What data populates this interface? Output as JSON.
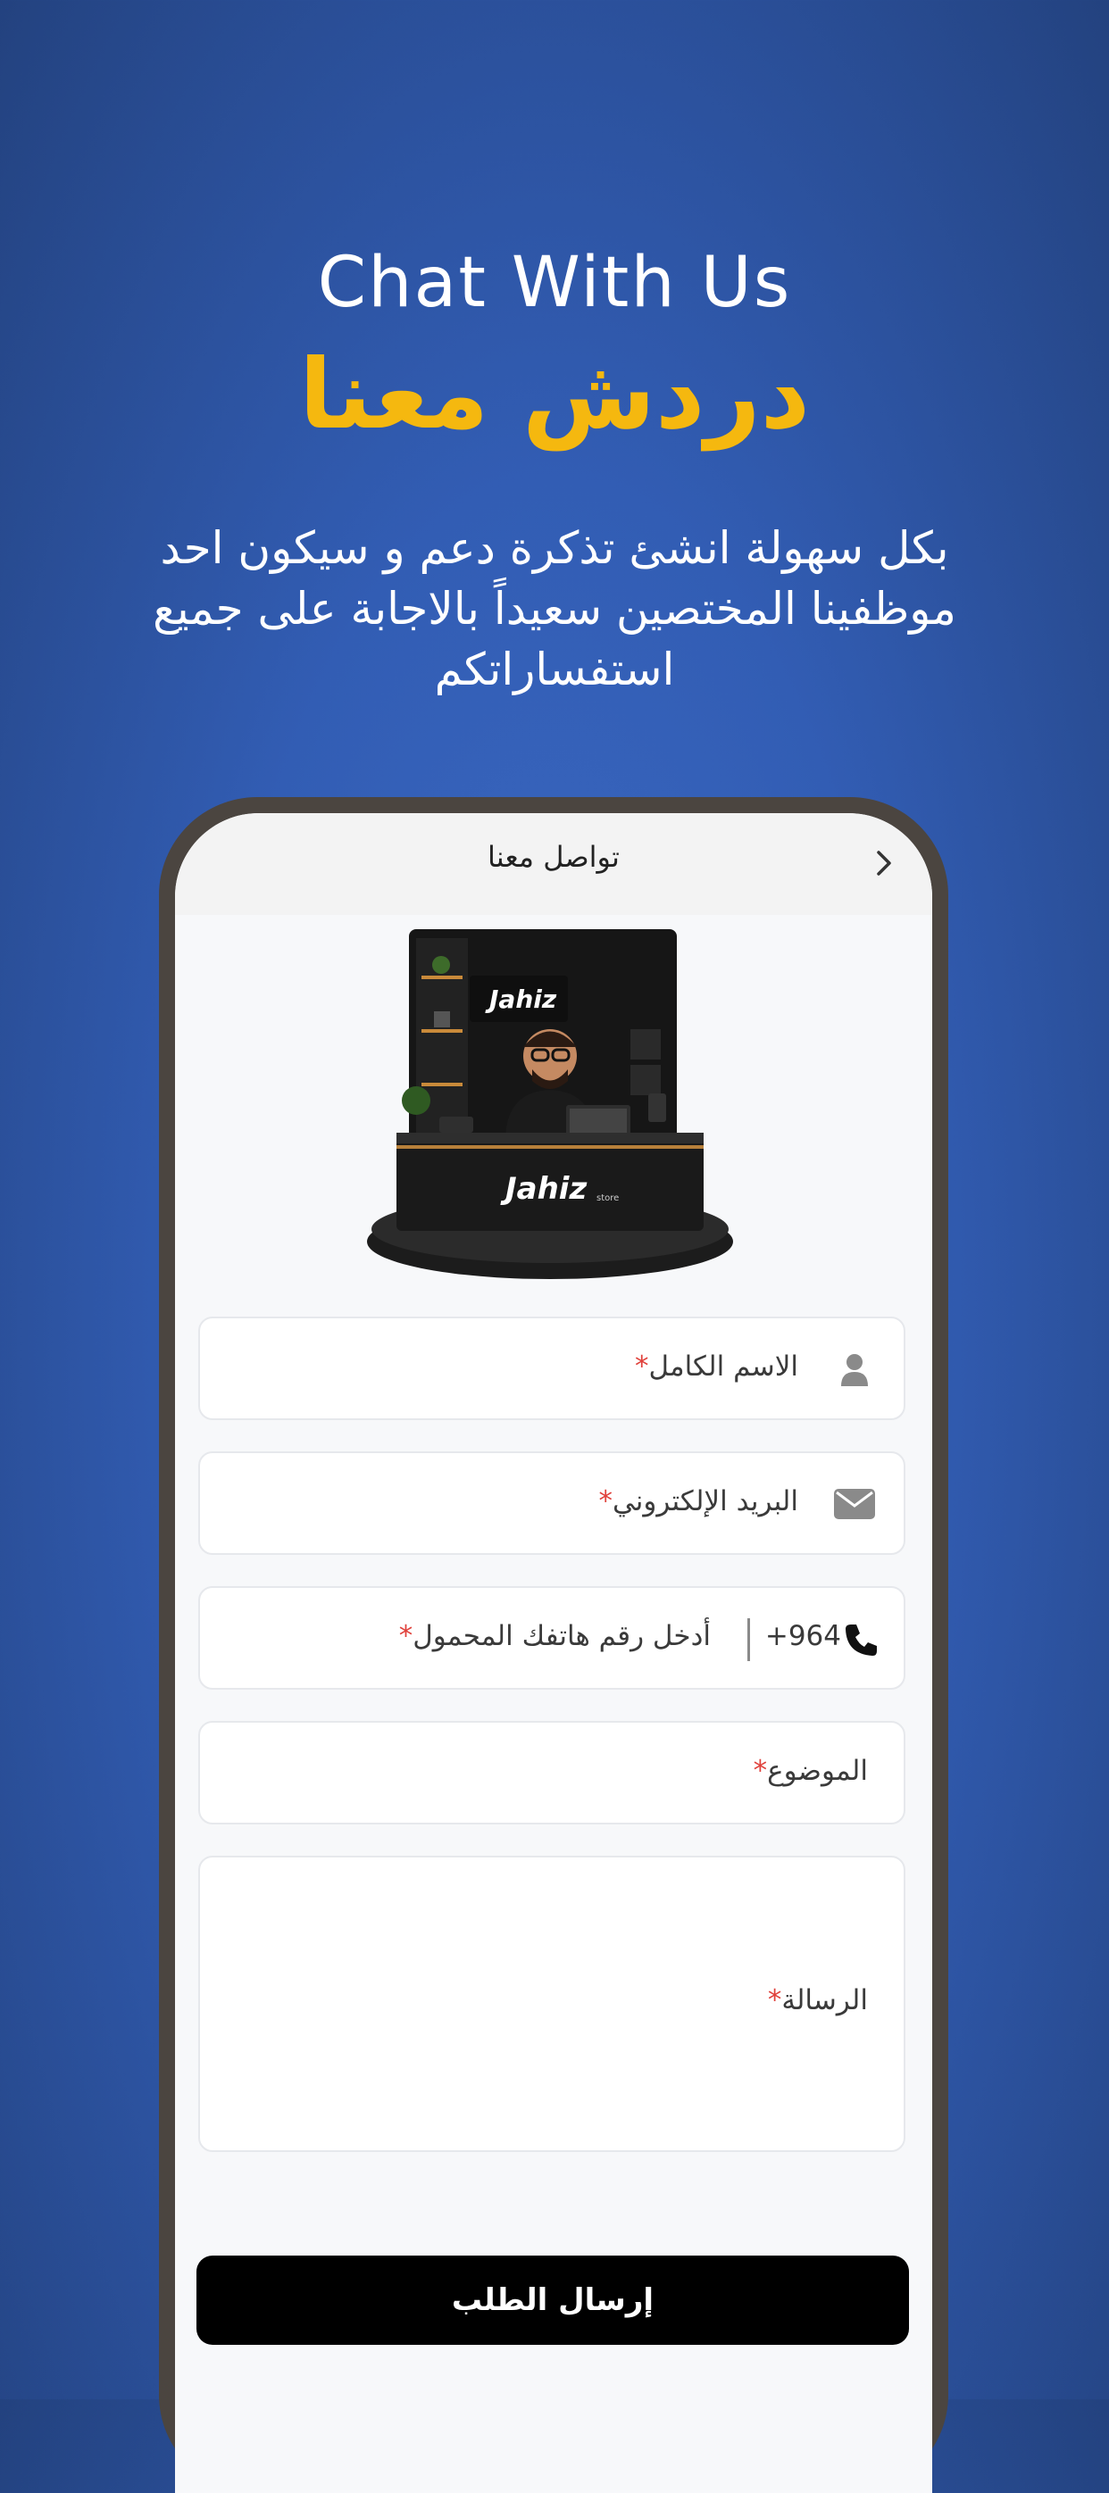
{
  "hero": {
    "title_en": "Chat With Us",
    "title_ar": "دردش معنا",
    "description": "بكل سهولة انشئ تذكرة دعم و سيكون احد موظفينا المختصين سعيداً بالاجابة على جميع استفساراتكم"
  },
  "app": {
    "header_title": "تواصل معنا",
    "illustration": {
      "brand_text": "Jahiz",
      "brand_sub": "store"
    },
    "form": {
      "full_name_label": "الاسم الكامل",
      "email_label": "البريد الإلكتروني",
      "country_code": "+964",
      "phone_placeholder": "أدخل رقم هاتفك المحمول",
      "subject_label": "الموضوع",
      "message_label": "الرسالة",
      "required_mark": "*"
    },
    "submit_label": "إرسال الطلب"
  },
  "colors": {
    "accent_yellow": "#f5b80f",
    "background_blue": "#325db4",
    "required_red": "#e0413b",
    "button_black": "#000000"
  },
  "icons": [
    "back-chevron-icon",
    "user-icon",
    "envelope-icon",
    "phone-icon"
  ]
}
